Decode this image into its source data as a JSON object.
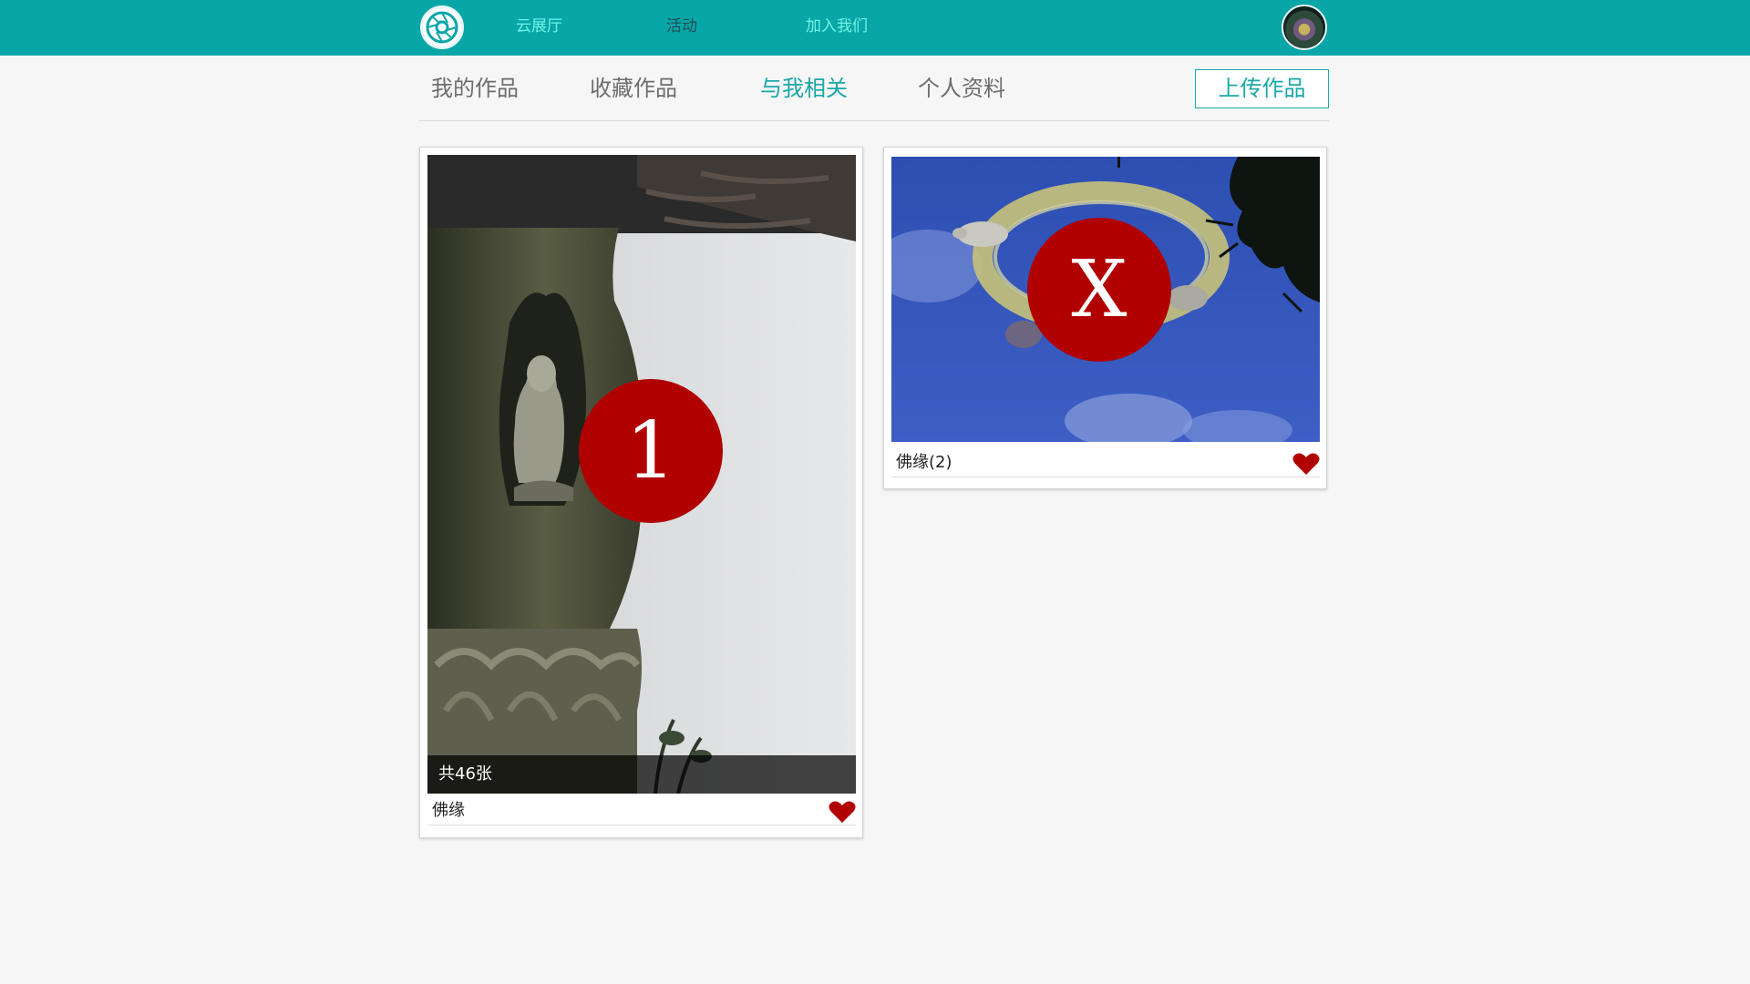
{
  "colors": {
    "topbar_bg": "#08a6a7",
    "topnav_active": "#6ff3e6",
    "topnav_text": "#1c4f55",
    "accent": "#19a7a8",
    "tab_text": "#6d6d6d",
    "badge": "#b10000",
    "heart": "#b10000",
    "page_bg": "#f6f6f6"
  },
  "topbar": {
    "logo_icon": "camera-aperture-icon",
    "nav": [
      {
        "label": "云展厅",
        "active": true
      },
      {
        "label": "活动",
        "active": false
      },
      {
        "label": "加入我们",
        "active": true
      }
    ],
    "avatar_icon": "user-avatar"
  },
  "subnav": {
    "tabs": [
      {
        "label": "我的作品",
        "active": false
      },
      {
        "label": "收藏作品",
        "active": false
      },
      {
        "label": "与我相关",
        "active": true
      },
      {
        "label": "个人资料",
        "active": false
      }
    ],
    "upload_label": "上传作品"
  },
  "cards": [
    {
      "title": "佛缘",
      "count_label": "共46张",
      "badge": "1",
      "favorite_icon": "heart-icon"
    },
    {
      "title": "佛缘(2)",
      "badge": "X",
      "favorite_icon": "heart-icon"
    }
  ]
}
